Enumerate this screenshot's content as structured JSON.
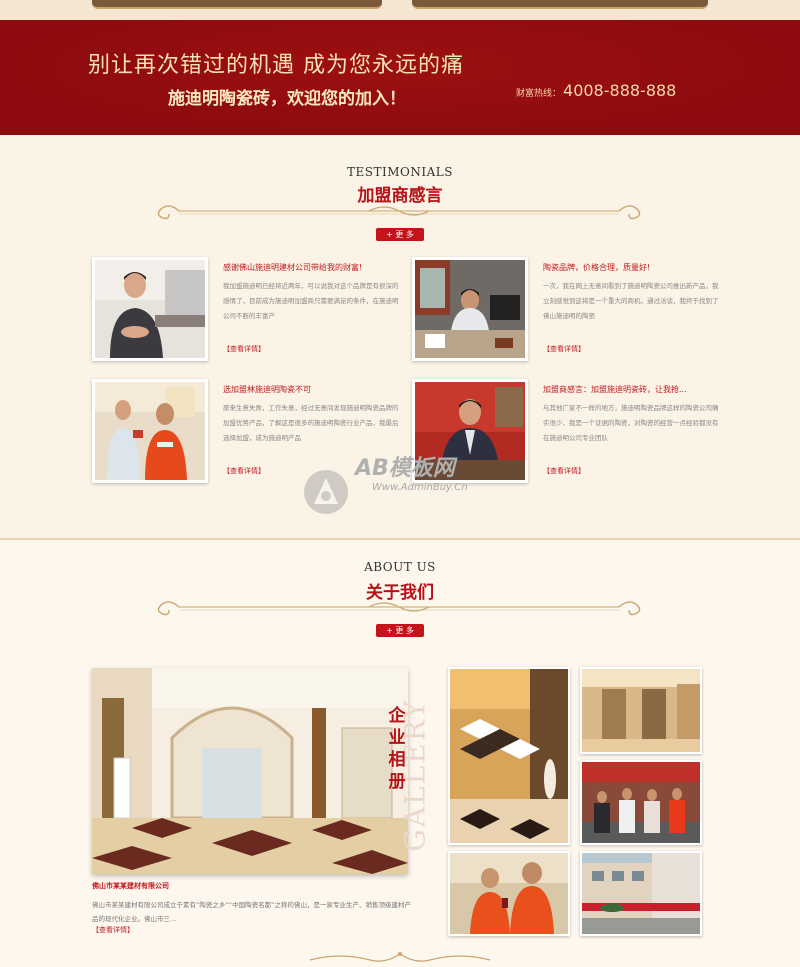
{
  "banner": {
    "line1": "别让再次错过的机遇 成为您永远的痛",
    "line2": "施迪明陶瓷砖，欢迎您的加入！",
    "hotline_label": "财富热线：",
    "hotline_number": "4008-888-888"
  },
  "testimonials": {
    "heading_en": "TESTIMONIALS",
    "heading_cn": "加盟商感言",
    "more_label": "+ 更 多",
    "items": [
      {
        "title": "感谢佛山施迪明建材公司带给我的财富!",
        "body": "我加盟施迪明已经将近两年，可以说我对这个品牌是有很深的感情了，目前成为施迪明加盟商只需要满足的条件，在施迪明公司不断的丰富产",
        "link": "【查看详情】"
      },
      {
        "title": "陶瓷品牌，价格合理，质量好!",
        "body": "一次，我在网上无意间看到了施迪明陶瓷公司推出新产品，我立刻感觉到这将是一个重大的商机，通过洽谈，我终于找到了佛山施迪明的陶瓷",
        "link": "【查看详情】"
      },
      {
        "title": "选加盟林施迪明陶瓷不可",
        "body": "原来生意失败，工作失意，经过无意间发现施迪明陶瓷品牌的加盟优势产品，了解这是很多的施迪明陶瓷行业产品，我最后选择加盟，成为施迪明产品",
        "link": "【查看详情】"
      },
      {
        "title": "加盟商感言：加盟施迪明瓷砖，让我抢...",
        "body": "与其他厂家不一样的地方，施迪明陶瓷品牌这样的陶瓷公司确实很少，我是一个证据的陶瓷，对陶瓷的经营一点经验都没有在施迪明公司专业团队",
        "link": "【查看详情】"
      }
    ]
  },
  "watermark": {
    "logo_text": "AB模板网",
    "url": "Www.AdminBuy.Cn"
  },
  "about": {
    "heading_en": "ABOUT US",
    "heading_cn": "关于我们",
    "more_label": "+ 更 多",
    "company": "佛山市某某建材有限公司",
    "description": "佛山市某某建材有限公司成立于素有“陶瓷之乡”“中国陶瓷名都”之称的佛山，是一家专业生产、销售顶级建材产品的现代化企业。佛山市三...",
    "link": "【查看详情】",
    "gallery_cn": "企业相册",
    "gallery_en": "GALLERY"
  },
  "colors": {
    "banner_red": "#8d0b0e",
    "accent_red": "#c4141b",
    "gold": "#c9a46a",
    "cream": "#fbf3e6"
  }
}
